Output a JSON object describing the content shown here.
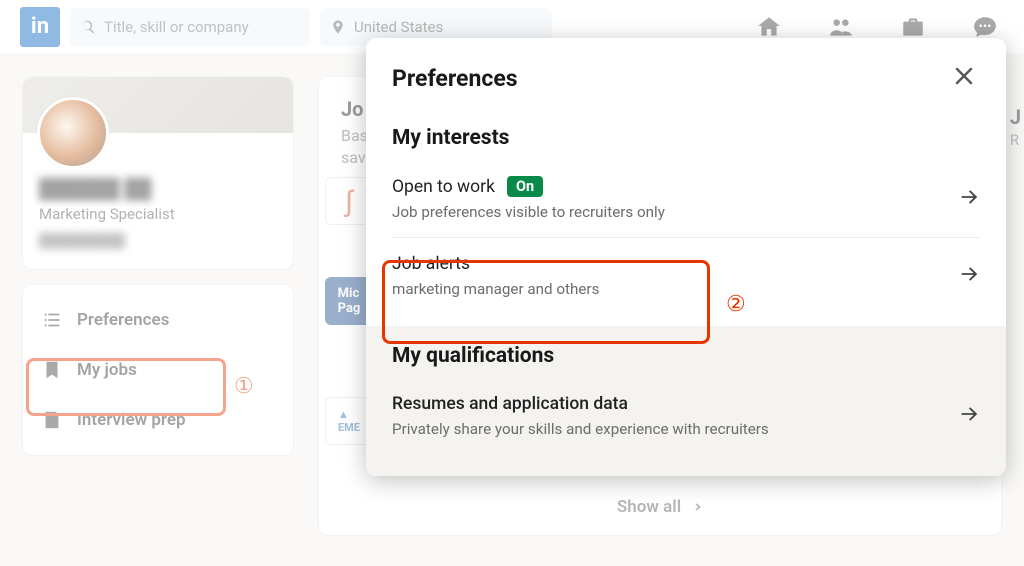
{
  "search": {
    "placeholder": "Title, skill or company",
    "location_value": "United States"
  },
  "profile": {
    "name": "██████ ██",
    "role": "Marketing Specialist",
    "location": "█████████"
  },
  "sidebar": {
    "items": [
      {
        "label": "Preferences"
      },
      {
        "label": "My jobs"
      },
      {
        "label": "Interview prep"
      }
    ]
  },
  "main": {
    "jobs_title_prefix": "Jo",
    "peek_right_letter": "J",
    "show_all": "Show all"
  },
  "modal": {
    "title": "Preferences",
    "interests_h": "My interests",
    "open_to_work": {
      "title": "Open to work",
      "badge": "On",
      "sub": "Job preferences visible to recruiters only"
    },
    "job_alerts": {
      "title": "Job alerts",
      "sub": "marketing manager and others"
    },
    "qualifications_h": "My qualifications",
    "resumes": {
      "title": "Resumes and application data",
      "sub": "Privately share your skills and experience with recruiters"
    }
  },
  "annotations": {
    "one": "①",
    "two": "②"
  }
}
